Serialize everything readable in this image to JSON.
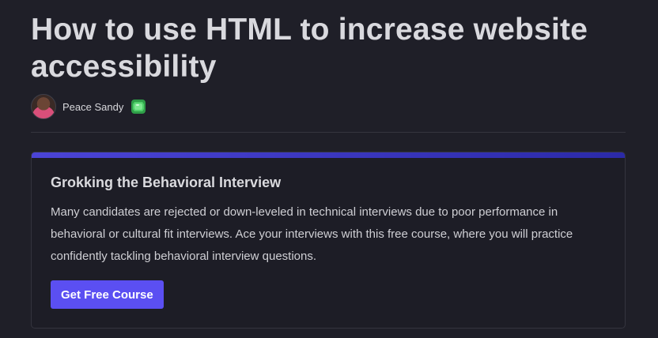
{
  "article": {
    "title": "How to use HTML to increase website accessibility",
    "author": {
      "name": "Peace Sandy",
      "badge_icon": "green-gem-icon"
    }
  },
  "promo_card": {
    "title": "Grokking the Behavioral Interview",
    "description": "Many candidates are rejected or down-leveled in technical interviews due to poor performance in behavioral or cultural fit interviews. Ace your interviews with this free course, where you will practice confidently tackling behavioral interview questions.",
    "cta_label": "Get Free Course",
    "accent_color": "#5b4ff2"
  },
  "theme": {
    "background": "#1f1f28",
    "gem_color": "#4fd06a"
  }
}
